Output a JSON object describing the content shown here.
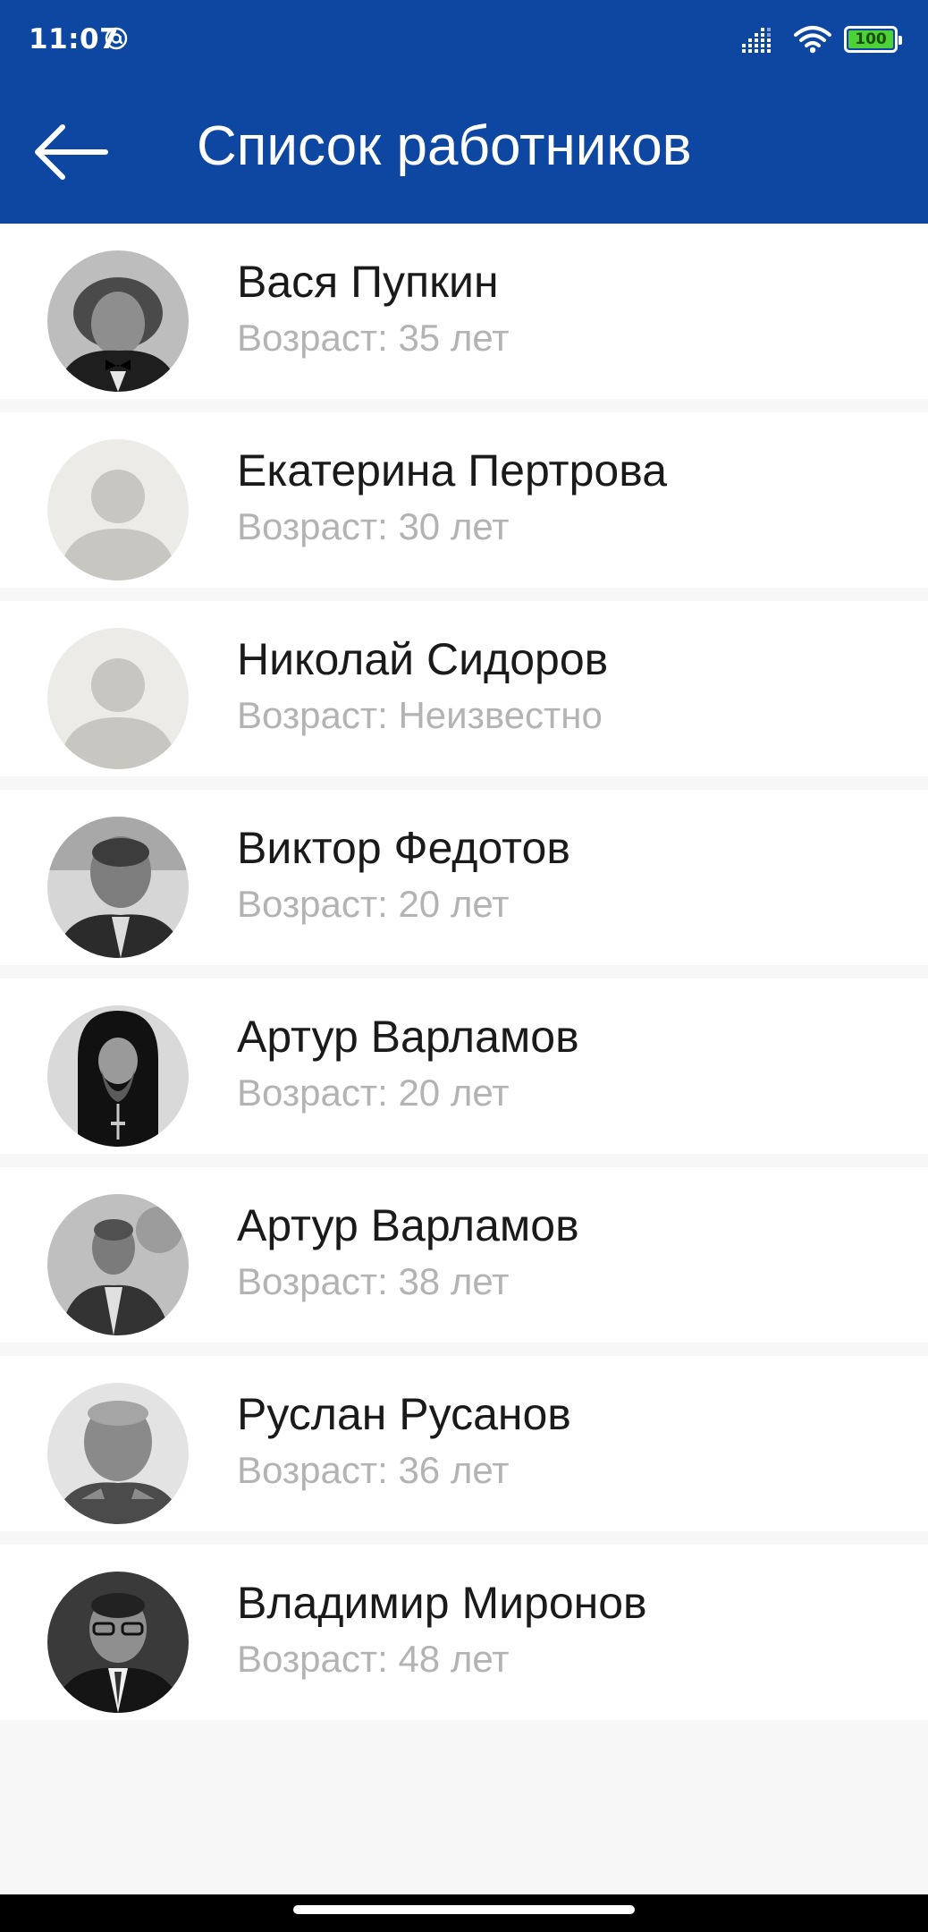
{
  "status_bar": {
    "time": "11:07",
    "battery_level": "100",
    "battery_color": "#4cd137",
    "icons": [
      "at-sign-icon",
      "signal-icon",
      "wifi-icon",
      "battery-icon"
    ]
  },
  "app_bar": {
    "title": "Список работников",
    "back_icon": "arrow-left-icon",
    "background": "#0d47a1"
  },
  "employees": [
    {
      "name": "Вася Пупкин",
      "age": "Возраст: 35 лет",
      "avatar": "photo"
    },
    {
      "name": "Екатерина Пертрова",
      "age": "Возраст: 30 лет",
      "avatar": "placeholder"
    },
    {
      "name": "Николай Сидоров",
      "age": "Возраст: Неизвестно",
      "avatar": "placeholder"
    },
    {
      "name": "Виктор Федотов",
      "age": "Возраст: 20 лет",
      "avatar": "photo"
    },
    {
      "name": "Артур Варламов",
      "age": "Возраст: 20 лет",
      "avatar": "photo"
    },
    {
      "name": "Артур Варламов",
      "age": "Возраст: 38 лет",
      "avatar": "photo"
    },
    {
      "name": "Руслан Русанов",
      "age": "Возраст: 36 лет",
      "avatar": "photo"
    },
    {
      "name": "Владимир Миронов",
      "age": "Возраст: 48 лет",
      "avatar": "photo"
    }
  ]
}
